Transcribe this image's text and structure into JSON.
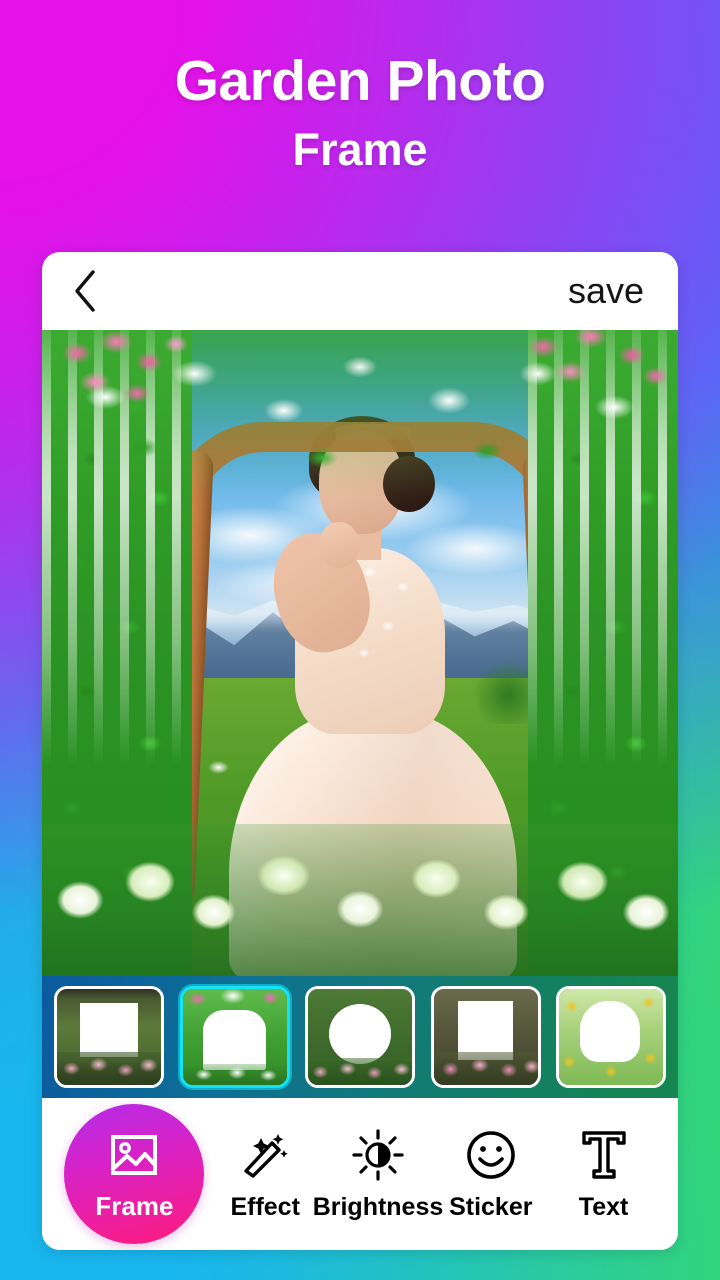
{
  "app": {
    "title_line1": "Garden Photo",
    "title_line2": "Frame"
  },
  "header": {
    "back_icon": "chevron-left-icon",
    "save_label": "save"
  },
  "editor": {
    "photo_description": "Bride in cream lace dress standing under a green floral arch with white wisteria, pink blossoms and white roses, mountain meadow background",
    "selected_frame_index": 1
  },
  "frames": [
    {
      "id": "frame-1",
      "name": "green-rectangle-rose-frame",
      "selected": false
    },
    {
      "id": "frame-2",
      "name": "floral-arch-frame",
      "selected": true
    },
    {
      "id": "frame-3",
      "name": "oval-garden-frame",
      "selected": false
    },
    {
      "id": "frame-4",
      "name": "vine-rectangle-frame",
      "selected": false
    },
    {
      "id": "frame-5",
      "name": "sunflower-garden-frame",
      "selected": false
    }
  ],
  "toolbar": {
    "items": [
      {
        "label": "Frame",
        "icon": "image-icon",
        "active": true
      },
      {
        "label": "Effect",
        "icon": "magic-wand-icon",
        "active": false
      },
      {
        "label": "Brightness",
        "icon": "brightness-icon",
        "active": false
      },
      {
        "label": "Sticker",
        "icon": "smiley-icon",
        "active": false
      },
      {
        "label": "Text",
        "icon": "text-t-icon",
        "active": false
      }
    ]
  },
  "colors": {
    "bg_top_left": "#e610e8",
    "bg_top_right": "#4a6afb",
    "bg_bottom_left": "#18b6ee",
    "bg_bottom_right": "#3ade55",
    "accent_active": "#ff1b7a",
    "selected_border": "#16e2f5",
    "card_bg": "#ffffff",
    "strip_bg_start": "#0b5a9e",
    "strip_bg_end": "#16864f"
  }
}
